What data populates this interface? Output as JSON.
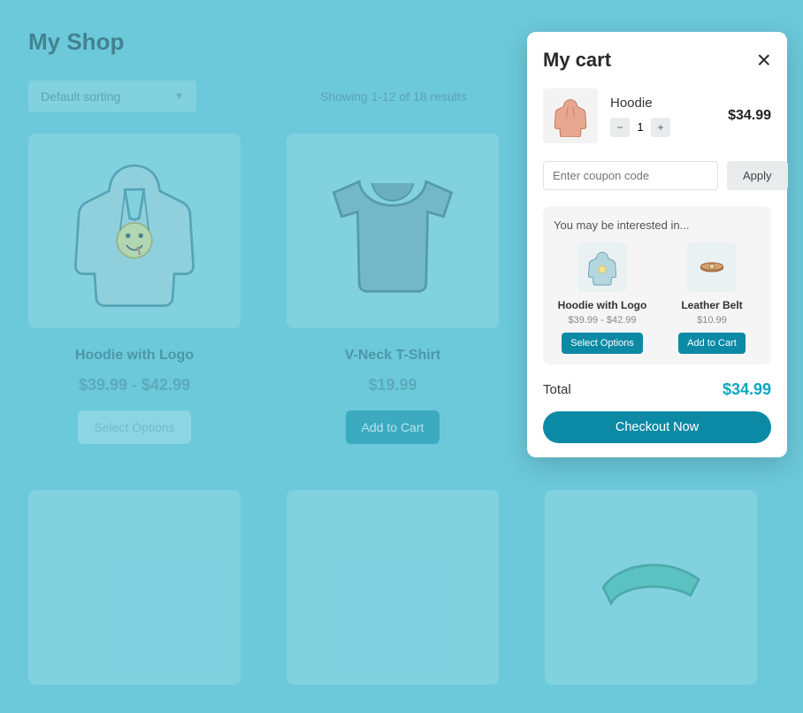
{
  "shop": {
    "title": "My Shop",
    "sort_label": "Default sorting",
    "showing": "Showing 1-12 of 18 results",
    "products": [
      {
        "name": "Hoodie with Logo",
        "price": "$39.99 - $42.99",
        "cta": "Select Options",
        "cta_style": "muted"
      },
      {
        "name": "V-Neck T-Shirt",
        "price": "$19.99",
        "cta": "Add to Cart",
        "cta_style": "teal"
      }
    ]
  },
  "cart": {
    "title": "My cart",
    "item": {
      "name": "Hoodie",
      "qty": "1",
      "price": "$34.99"
    },
    "coupon_placeholder": "Enter coupon code",
    "apply_label": "Apply",
    "suggest_title": "You may be interested in...",
    "suggestions": [
      {
        "name": "Hoodie with Logo",
        "price": "$39.99 - $42.99",
        "cta": "Select Options"
      },
      {
        "name": "Leather Belt",
        "price": "$10.99",
        "cta": "Add to Cart"
      }
    ],
    "total_label": "Total",
    "total_amount": "$34.99",
    "checkout_label": "Checkout Now"
  }
}
